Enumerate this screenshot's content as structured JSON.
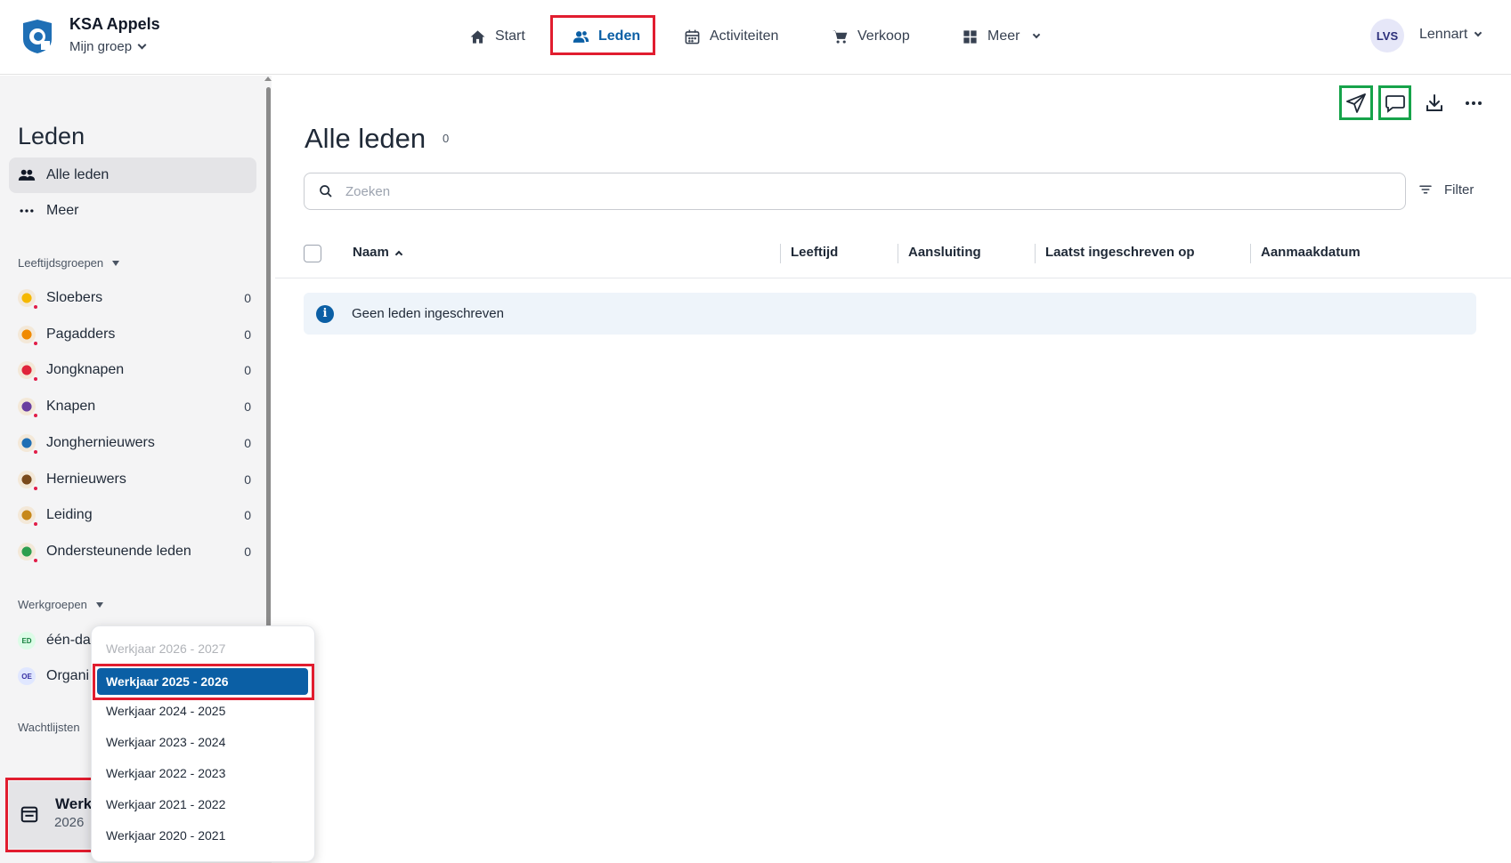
{
  "header": {
    "org_name": "KSA Appels",
    "group_selector": "Mijn groep",
    "nav": [
      {
        "label": "Start",
        "icon": "home-icon"
      },
      {
        "label": "Leden",
        "icon": "members-icon",
        "active": true
      },
      {
        "label": "Activiteiten",
        "icon": "calendar-icon"
      },
      {
        "label": "Verkoop",
        "icon": "cart-icon"
      },
      {
        "label": "Meer",
        "icon": "grid-icon"
      }
    ],
    "user_initials": "LVS",
    "user_name": "Lennart"
  },
  "sidebar": {
    "title": "Leden",
    "items": [
      {
        "label": "Alle leden",
        "icon": "members-icon",
        "active": true
      },
      {
        "label": "Meer",
        "icon": "more-horizontal-icon"
      }
    ],
    "age_groups_label": "Leeftijdsgroepen",
    "age_groups": [
      {
        "label": "Sloebers",
        "count": "0",
        "color": "#f5b800"
      },
      {
        "label": "Pagadders",
        "count": "0",
        "color": "#f08a00"
      },
      {
        "label": "Jongknapen",
        "count": "0",
        "color": "#e0243a"
      },
      {
        "label": "Knapen",
        "count": "0",
        "color": "#6a3fa0"
      },
      {
        "label": "Jonghernieuwers",
        "count": "0",
        "color": "#1f6fb5"
      },
      {
        "label": "Hernieuwers",
        "count": "0",
        "color": "#7a4a1c"
      },
      {
        "label": "Leiding",
        "count": "0",
        "color": "#c7881a"
      },
      {
        "label": "Ondersteunende leden",
        "count": "0",
        "color": "#2e9e4f"
      }
    ],
    "workgroups_label": "Werkgroepen",
    "workgroups": [
      {
        "badge": "ED",
        "label": "één-da",
        "color": "#15803d",
        "bg": "#dcfce7"
      },
      {
        "badge": "OE",
        "label": "Organi",
        "color": "#3730a3",
        "bg": "#e0e7ff"
      }
    ],
    "waitlists_label": "Wachtlijsten",
    "werkjaar_button": {
      "title": "Werk",
      "subtitle": "2026"
    }
  },
  "dropdown": {
    "options": [
      {
        "label": "Werkjaar 2026 - 2027",
        "state": "disabled"
      },
      {
        "label": "Werkjaar 2025 - 2026",
        "state": "selected"
      },
      {
        "label": "Werkjaar 2024 - 2025",
        "state": "normal"
      },
      {
        "label": "Werkjaar 2023 - 2024",
        "state": "normal"
      },
      {
        "label": "Werkjaar 2022 - 2023",
        "state": "normal"
      },
      {
        "label": "Werkjaar 2021 - 2022",
        "state": "normal"
      },
      {
        "label": "Werkjaar 2020 - 2021",
        "state": "normal"
      }
    ]
  },
  "main": {
    "title": "Alle leden",
    "count": "0",
    "toolbar": [
      "send-icon",
      "chat-icon",
      "download-icon",
      "more-horizontal-icon"
    ],
    "search_placeholder": "Zoeken",
    "filter_label": "Filter",
    "columns": [
      "Naam",
      "Leeftijd",
      "Aansluiting",
      "Laatst ingeschreven op",
      "Aanmaakdatum"
    ],
    "empty_message": "Geen leden ingeschreven"
  },
  "colors": {
    "accent": "#0b5fa5",
    "highlight_red": "#e11d2f",
    "highlight_green": "#16a34a"
  }
}
